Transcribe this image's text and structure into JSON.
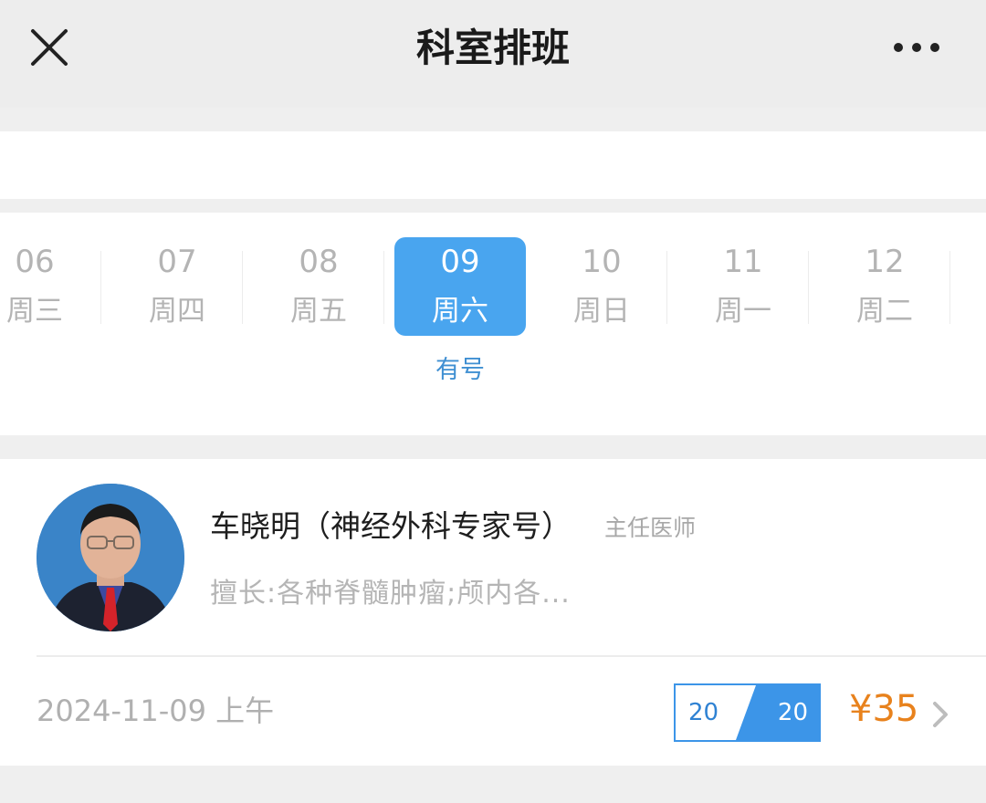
{
  "header": {
    "title": "科室排班",
    "close_icon": "close-icon",
    "more_icon": "more-horizontal-icon"
  },
  "dates": [
    {
      "num": "06",
      "weekday": "周三",
      "status": ""
    },
    {
      "num": "07",
      "weekday": "周四",
      "status": ""
    },
    {
      "num": "08",
      "weekday": "周五",
      "status": ""
    },
    {
      "num": "09",
      "weekday": "周六",
      "status": "有号",
      "selected": true
    },
    {
      "num": "10",
      "weekday": "周日",
      "status": ""
    },
    {
      "num": "11",
      "weekday": "周一",
      "status": ""
    },
    {
      "num": "12",
      "weekday": "周二",
      "status": ""
    }
  ],
  "doctor": {
    "name": "车晓明（神经外科专家号）",
    "title": "主任医师",
    "specialty": "擅长:各种脊髓肿瘤;颅内各...",
    "slot": {
      "datetime": "2024-11-09 上午",
      "remaining": "20",
      "total": "20",
      "price": "¥35"
    }
  },
  "colors": {
    "accent": "#49a5ef",
    "status_text": "#3f8fd2",
    "price": "#e8821d"
  }
}
